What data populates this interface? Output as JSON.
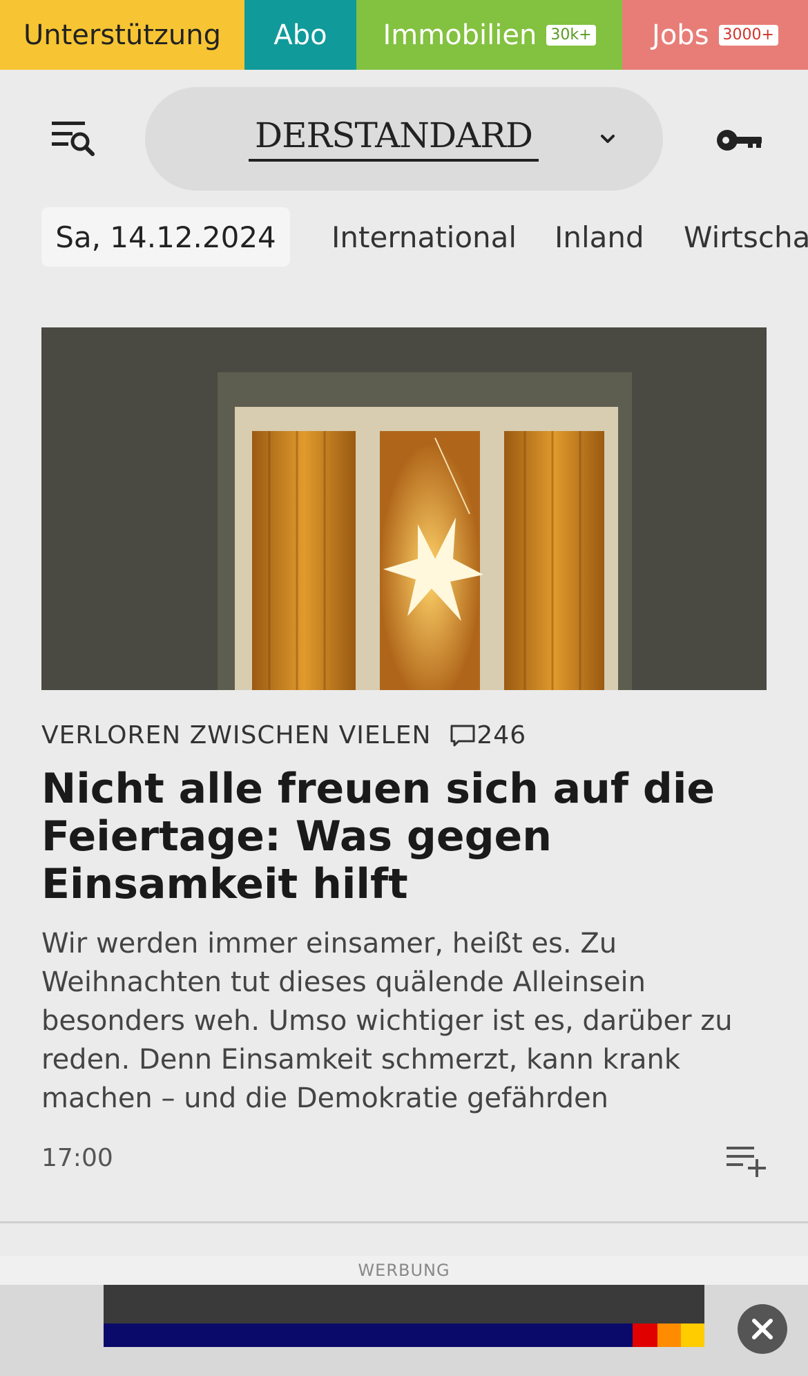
{
  "topbar": {
    "unterstuetzung": "Unterstützung",
    "abo": "Abo",
    "immobilien": "Immobilien",
    "immobilien_badge": "30k+",
    "jobs": "Jobs",
    "jobs_badge": "3000+",
    "colors": {
      "unterstuetzung": "#f7c533",
      "abo": "#119a9a",
      "immobilien": "#83c140",
      "jobs": "#e87d78"
    }
  },
  "header": {
    "logo": "DERSTANDARD",
    "menu_icon": "menu-search-icon",
    "chevron_icon": "chevron-down-icon",
    "key_icon": "key-icon"
  },
  "nav": {
    "date": "Sa, 14.12.2024",
    "items": [
      "International",
      "Inland",
      "Wirtschaft"
    ]
  },
  "article": {
    "image_icon": "window-star-photo",
    "kicker": "VERLOREN ZWISCHEN VIELEN",
    "comment_icon": "comment-icon",
    "comment_count": "246",
    "headline": "Nicht alle freuen sich auf die Feiertage: Was gegen Einsamkeit hilft",
    "teaser": "Wir werden immer einsamer, heißt es. Zu Weihnachten tut dieses quälende Alleinsein besonders weh. Umso wichtiger ist es, darüber zu reden. Denn Einsamkeit schmerzt, kann krank machen – und die Demokratie gefährden",
    "time": "17:00",
    "add_icon": "playlist-add-icon"
  },
  "ad": {
    "label": "WERBUNG",
    "close_icon": "close-icon"
  }
}
